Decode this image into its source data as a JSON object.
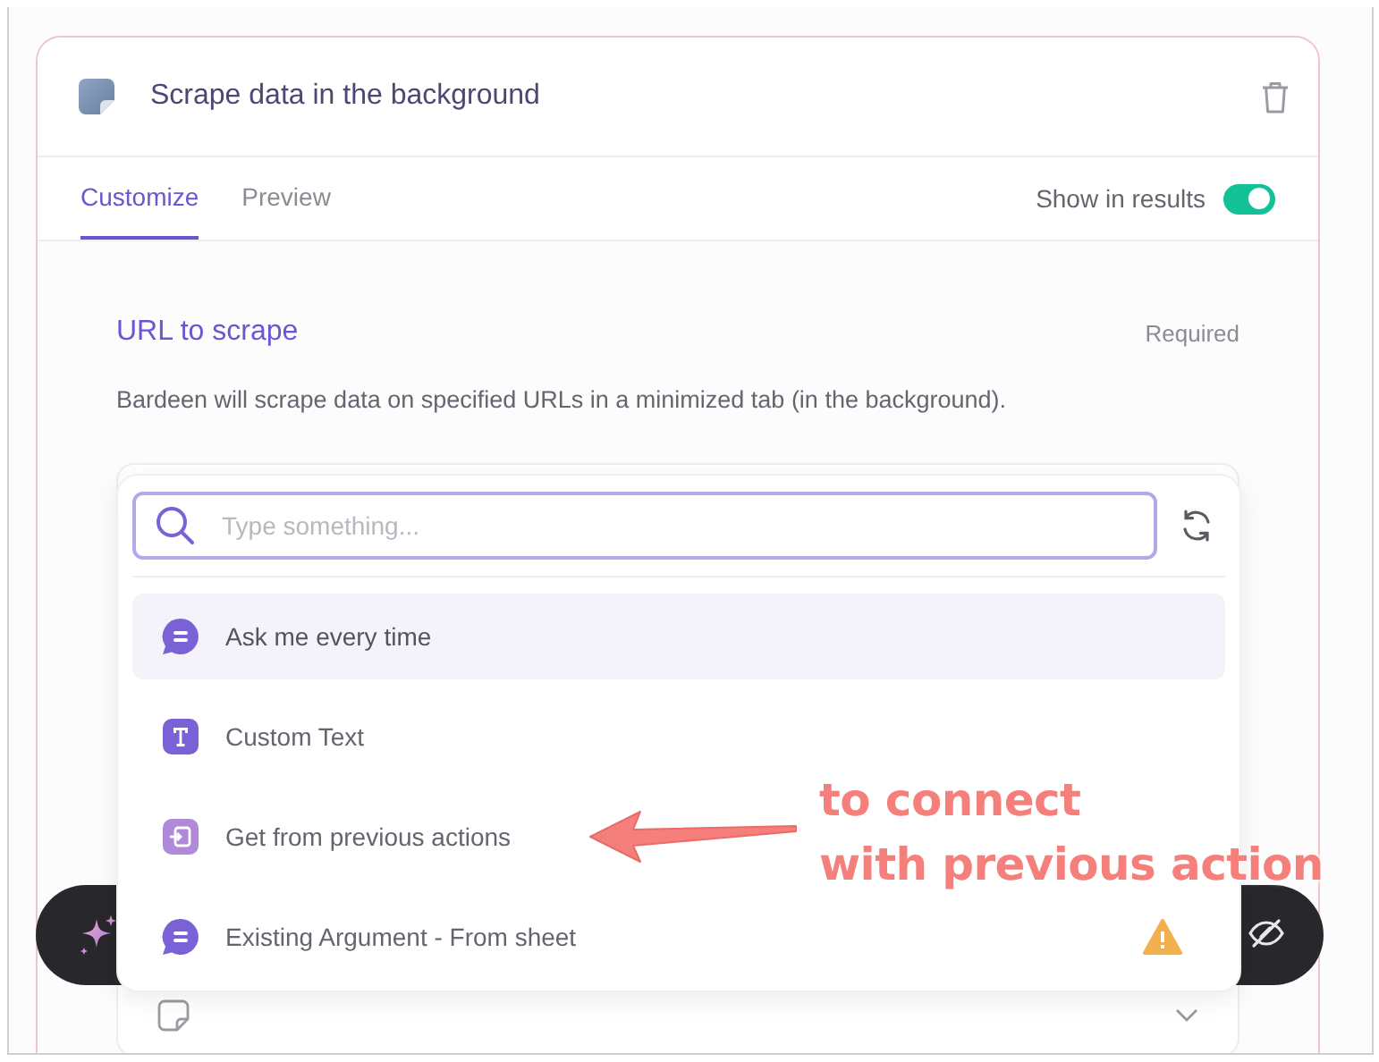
{
  "card": {
    "title": "Scrape data in the background"
  },
  "tabs": [
    {
      "label": "Customize",
      "selected": true
    },
    {
      "label": "Preview",
      "selected": false
    }
  ],
  "show_in_results": {
    "label": "Show in results",
    "on": true
  },
  "field": {
    "label": "URL to scrape",
    "required": "Required",
    "description": "Bardeen will scrape data on specified URLs in a minimized tab (in the background)."
  },
  "search": {
    "placeholder": "Type something..."
  },
  "options": [
    {
      "label": "Ask me every time",
      "kind": "chat",
      "selected": true,
      "warning": false
    },
    {
      "label": "Custom Text",
      "kind": "text",
      "selected": false,
      "warning": false
    },
    {
      "label": "Get from previous actions",
      "kind": "import",
      "selected": false,
      "warning": false
    },
    {
      "label": "Existing Argument - From sheet",
      "kind": "chat",
      "selected": false,
      "warning": true
    }
  ],
  "annotation": {
    "text": "to connect\nwith previous action"
  }
}
